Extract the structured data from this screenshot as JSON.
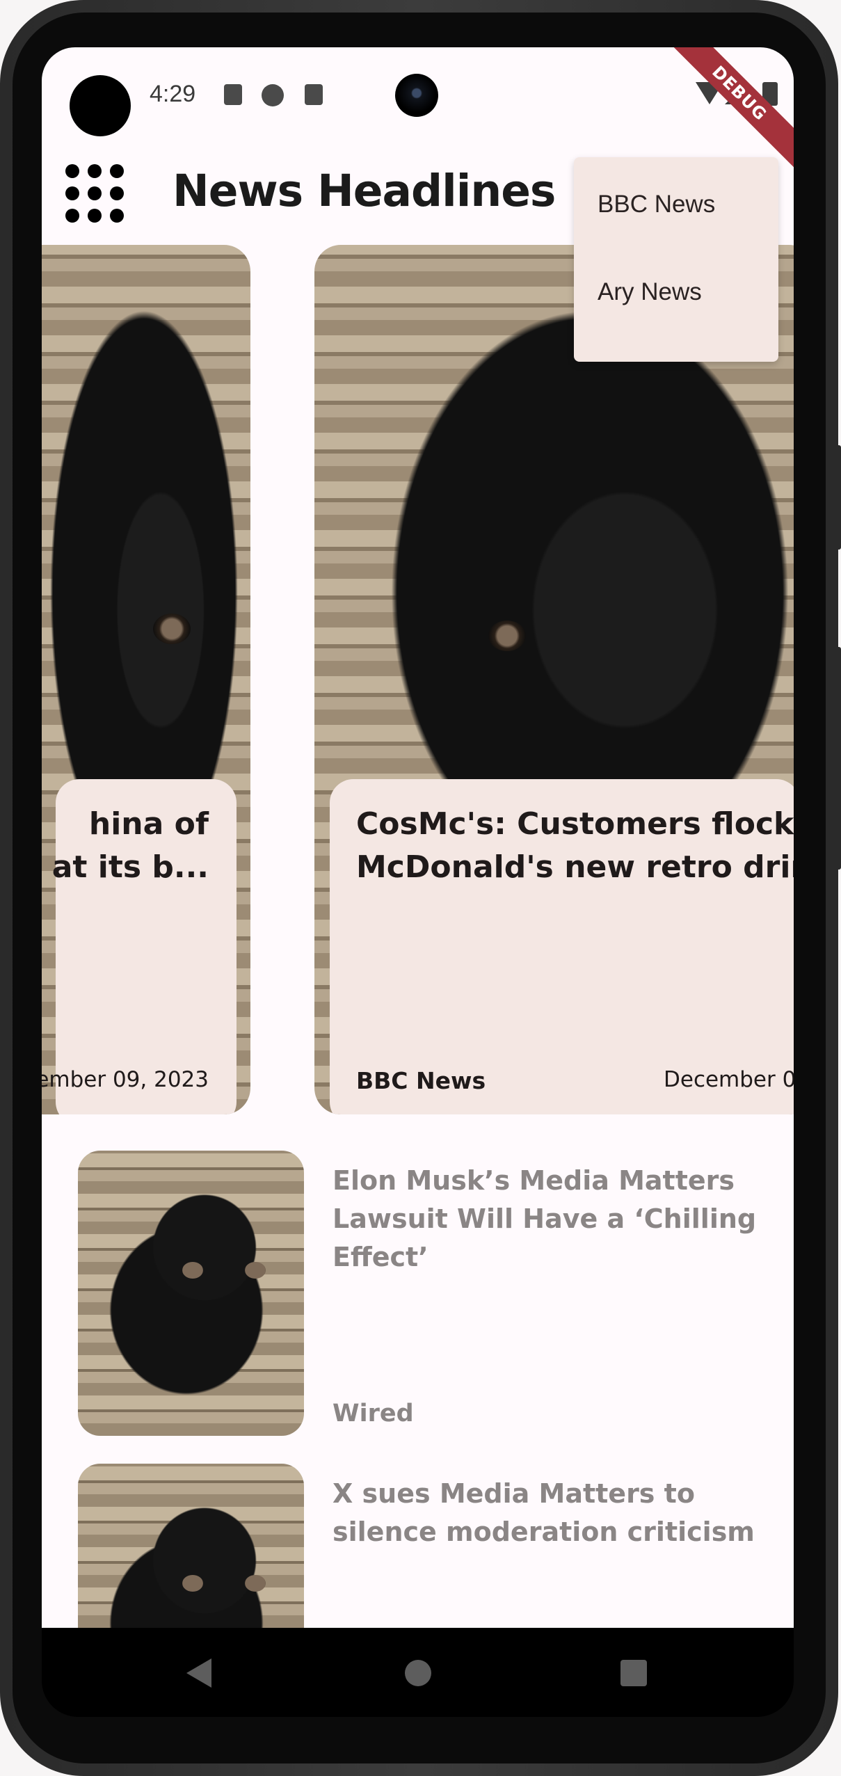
{
  "status_bar": {
    "time": "4:29",
    "icons": [
      "a-notification-icon",
      "data-saver-icon",
      "sd-card-icon",
      "wifi-icon",
      "signal-icon",
      "battery-icon"
    ]
  },
  "debug_banner": "DEBUG",
  "app_bar": {
    "title": "News Headlines",
    "menu_icon": "grid-dots-icon"
  },
  "popup_menu": {
    "items": [
      "BBC News",
      "Ary News"
    ]
  },
  "carousel": {
    "cards": [
      {
        "title_line1": "hina of",
        "title_line2": "n at its b...",
        "source": "",
        "date": "ember 09, 2023"
      },
      {
        "title_line1": "CosMc's: Customers flock t",
        "title_line2": "McDonald's new retro drink",
        "source": "BBC News",
        "date": "December 0"
      }
    ]
  },
  "news_list": [
    {
      "title": "Elon Musk’s Media Matters Lawsuit Will Have a ‘Chilling Effect’",
      "source": "Wired"
    },
    {
      "title": "X sues Media Matters to silence moderation criticism",
      "source": ""
    }
  ],
  "colors": {
    "card_panel": "#f4e7e3",
    "list_text": "#8a8585",
    "debug_banner": "#a4323b"
  }
}
